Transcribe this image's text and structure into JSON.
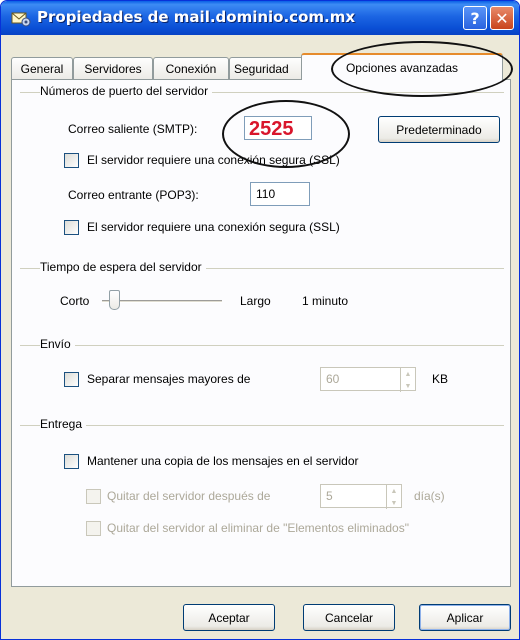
{
  "window": {
    "title": "Propiedades de mail.dominio.com.mx",
    "help_glyph": "?",
    "close_glyph": "✕"
  },
  "tabs": [
    {
      "label": "General"
    },
    {
      "label": "Servidores"
    },
    {
      "label": "Conexión"
    },
    {
      "label": "Seguridad"
    },
    {
      "label": "Opciones avanzadas",
      "active": true
    }
  ],
  "ports": {
    "group_label": "Números de puerto del servidor",
    "smtp_label": "Correo saliente (SMTP):",
    "smtp_value": "2525",
    "default_button": "Predeterminado",
    "smtp_ssl_label": "El servidor requiere una conexión segura (SSL)",
    "pop3_label": "Correo entrante (POP3):",
    "pop3_value": "110",
    "pop3_ssl_label": "El servidor requiere una conexión segura (SSL)"
  },
  "timeout": {
    "group_label": "Tiempo de espera del servidor",
    "short_label": "Corto",
    "long_label": "Largo",
    "value_text": "1 minuto",
    "slider_level": 0.1
  },
  "sending": {
    "group_label": "Envío",
    "split_label": "Separar mensajes mayores de",
    "split_value": "60",
    "unit": "KB"
  },
  "delivery": {
    "group_label": "Entrega",
    "keep_copy_label": "Mantener una copia de los mensajes en el servidor",
    "remove_after_label": "Quitar del servidor después de",
    "remove_after_value": "5",
    "days_label": "día(s)",
    "remove_deleted_label": "Quitar del servidor al eliminar de \"Elementos eliminados\""
  },
  "buttons": {
    "ok": "Aceptar",
    "cancel": "Cancelar",
    "apply": "Aplicar"
  },
  "colors": {
    "title_bar": "#0a4fd5",
    "smtp_value": "#d9152b",
    "dialog_bg": "#ece9d8"
  }
}
